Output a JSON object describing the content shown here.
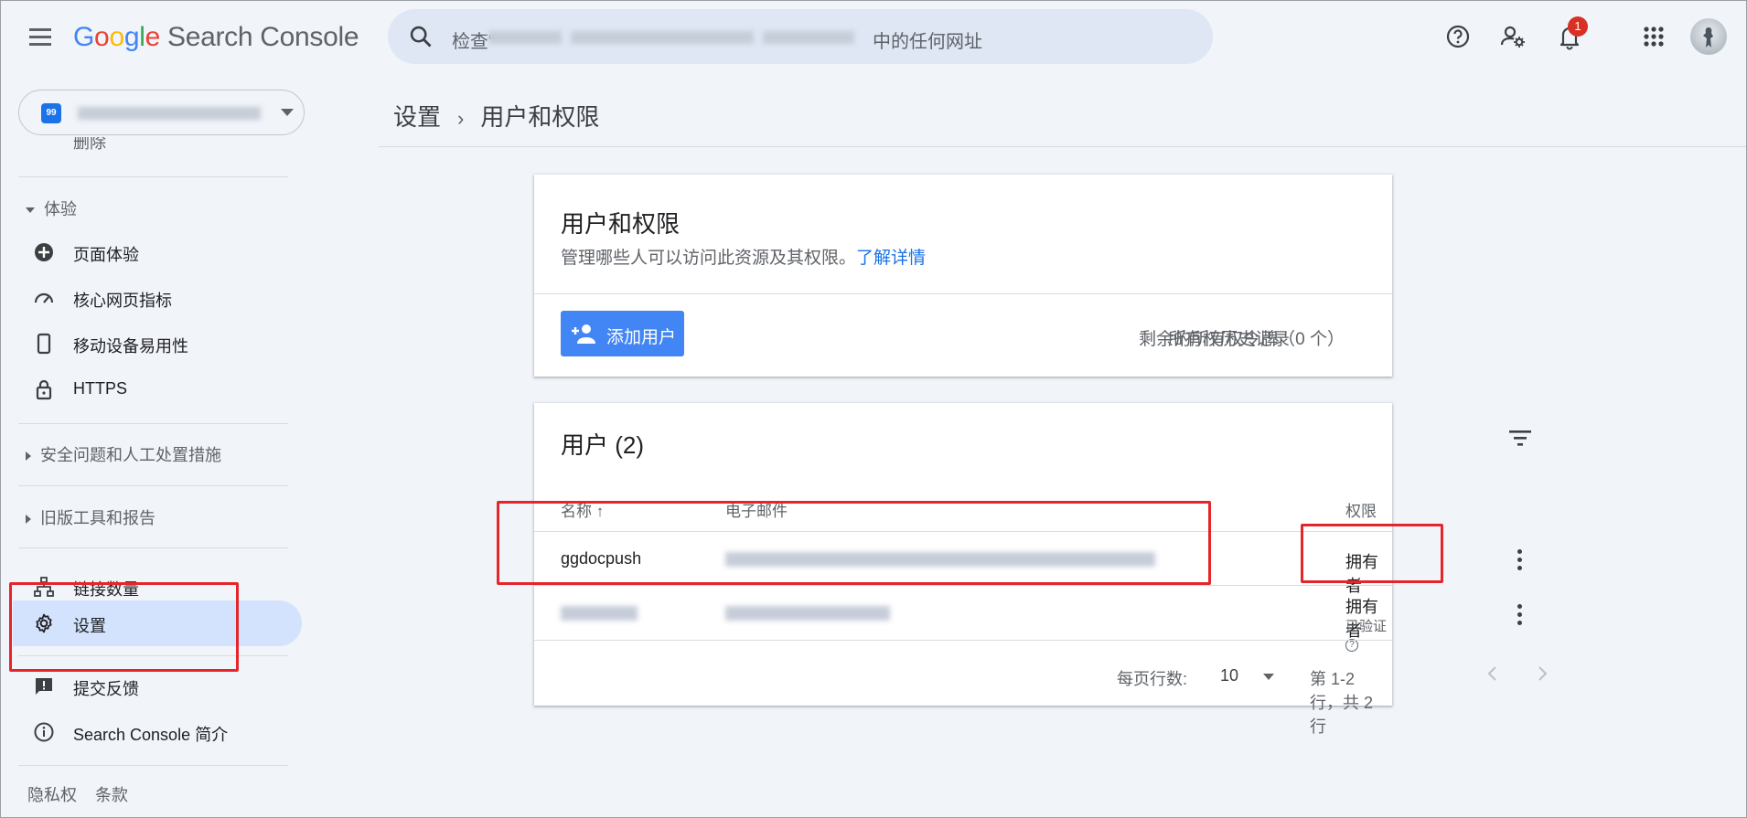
{
  "header": {
    "app_title": "Search Console",
    "search_prefix": "检查“",
    "search_suffix": "中的任何网址",
    "notification_count": "1"
  },
  "sidebar": {
    "cut_item_label": "删除",
    "sections": {
      "experience": "体验",
      "security": "安全问题和人工处置措施",
      "legacy": "旧版工具和报告"
    },
    "items": [
      {
        "label": "页面体验",
        "icon": "page-experience-icon"
      },
      {
        "label": "核心网页指标",
        "icon": "speed-gauge-icon"
      },
      {
        "label": "移动设备易用性",
        "icon": "phone-icon"
      },
      {
        "label": "HTTPS",
        "icon": "lock-icon"
      },
      {
        "label": "链接数量",
        "icon": "links-icon"
      },
      {
        "label": "设置",
        "icon": "gear-icon"
      },
      {
        "label": "提交反馈",
        "icon": "feedback-icon"
      },
      {
        "label": "Search Console 简介",
        "icon": "info-icon"
      }
    ],
    "footer": {
      "privacy": "隐私权",
      "terms": "条款"
    }
  },
  "breadcrumb": {
    "parent": "设置",
    "current": "用户和权限"
  },
  "permissions_card": {
    "title": "用户和权限",
    "description": "管理哪些人可以访问此资源及其权限。",
    "learn_more": "了解详情",
    "add_user_label": "添加用户",
    "history_label": "所有权历史记录",
    "tokens_label": "剩余的所有权令牌（0 个）"
  },
  "users_card": {
    "title": "用户 (2)",
    "columns": {
      "name": "名称",
      "sort_arrow": "↑",
      "email": "电子邮件",
      "permission": "权限"
    },
    "rows": [
      {
        "name": "ggdocpush",
        "permission": "拥有者",
        "status": ""
      },
      {
        "name": "",
        "permission": "拥有者",
        "status": "已验证"
      }
    ],
    "pagination": {
      "rows_per_page_label": "每页行数:",
      "rows_per_page_value": "10",
      "range": "第 1-2 行，共 2 行"
    }
  },
  "colors": {
    "accent": "#1a73e8",
    "button": "#4285f4",
    "active_nav": "#d3e3fd",
    "annotation_red": "#e4262b"
  }
}
